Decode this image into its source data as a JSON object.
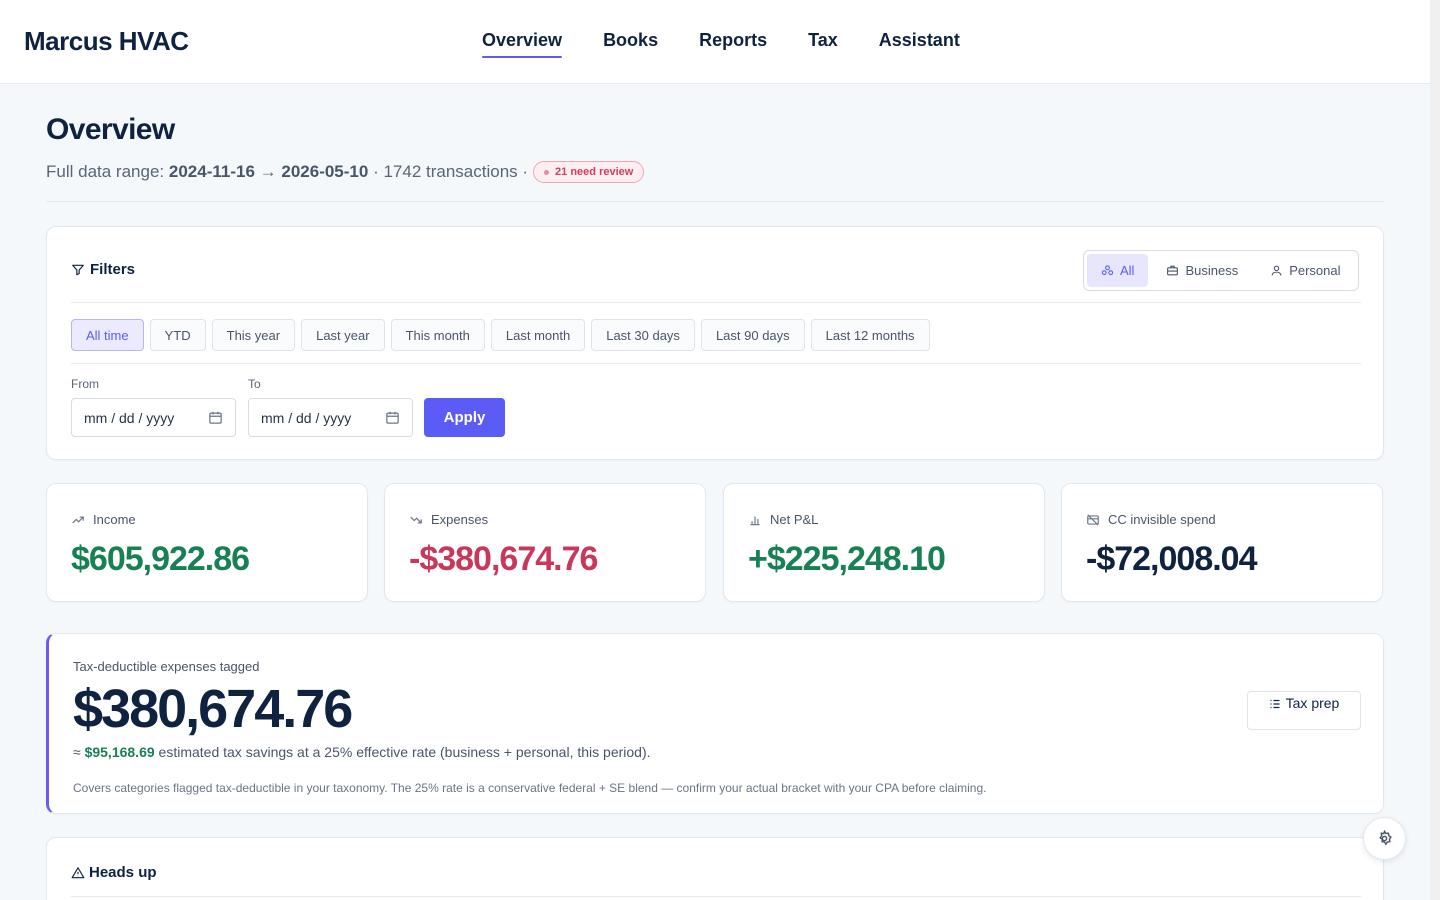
{
  "app": {
    "brand": "Marcus HVAC"
  },
  "nav": [
    {
      "label": "Overview",
      "active": true
    },
    {
      "label": "Books"
    },
    {
      "label": "Reports"
    },
    {
      "label": "Tax"
    },
    {
      "label": "Assistant"
    }
  ],
  "header": {
    "title": "Overview",
    "range_prefix": "Full data range:",
    "range_start": "2024-11-16",
    "range_arrow": "→",
    "range_end": "2026-05-10",
    "transactions": "· 1742 transactions ·",
    "review_badge": "21 need review"
  },
  "filters": {
    "title": "Filters",
    "scope": [
      {
        "label": "All",
        "icon": "group-icon",
        "active": true
      },
      {
        "label": "Business",
        "icon": "briefcase-icon"
      },
      {
        "label": "Personal",
        "icon": "user-icon"
      }
    ],
    "presets": [
      "All time",
      "YTD",
      "This year",
      "Last year",
      "This month",
      "Last month",
      "Last 30 days",
      "Last 90 days",
      "Last 12 months"
    ],
    "active_preset": "All time",
    "from_label": "From",
    "to_label": "To",
    "from_placeholder": "mm / dd / yyyy",
    "to_placeholder": "mm / dd / yyyy",
    "apply_label": "Apply"
  },
  "stats": [
    {
      "label": "Income",
      "icon": "trend-up-icon",
      "value": "$605,922.86",
      "color": "#178054"
    },
    {
      "label": "Expenses",
      "icon": "trend-down-icon",
      "value": "-$380,674.76",
      "color": "#c8385a"
    },
    {
      "label": "Net P&L",
      "icon": "bar-chart-icon",
      "value": "+$225,248.10",
      "color": "#178054"
    },
    {
      "label": "CC invisible spend",
      "icon": "card-off-icon",
      "value": "-$72,008.04",
      "color": "#0f2340"
    }
  ],
  "tax": {
    "label": "Tax-deductible expenses tagged",
    "value": "$380,674.76",
    "approx": "≈",
    "savings_amount": "$95,168.69",
    "savings_text": "estimated tax savings at a 25% effective rate (business + personal, this period).",
    "note": "Covers categories flagged tax-deductible in your taxonomy. The 25% rate is a conservative federal + SE blend — confirm your actual bracket with your CPA before claiming.",
    "button_label": "Tax prep"
  },
  "heads_up": {
    "title": "Heads up"
  },
  "colors": {
    "accent": "#5b5cf6",
    "positive": "#178054",
    "negative": "#c8385a",
    "text": "#0f2340"
  }
}
